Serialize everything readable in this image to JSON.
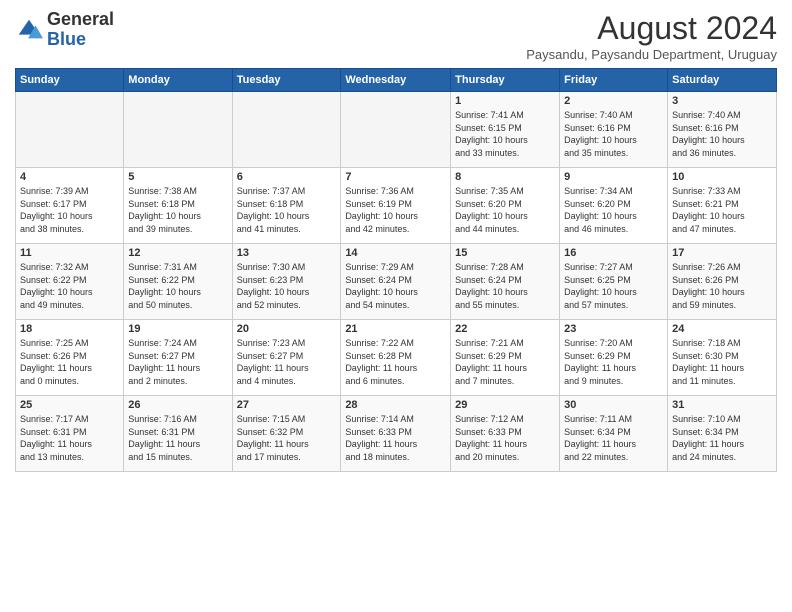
{
  "header": {
    "logo_general": "General",
    "logo_blue": "Blue",
    "main_title": "August 2024",
    "subtitle": "Paysandu, Paysandu Department, Uruguay"
  },
  "calendar": {
    "days_of_week": [
      "Sunday",
      "Monday",
      "Tuesday",
      "Wednesday",
      "Thursday",
      "Friday",
      "Saturday"
    ],
    "weeks": [
      [
        {
          "day": "",
          "info": ""
        },
        {
          "day": "",
          "info": ""
        },
        {
          "day": "",
          "info": ""
        },
        {
          "day": "",
          "info": ""
        },
        {
          "day": "1",
          "info": "Sunrise: 7:41 AM\nSunset: 6:15 PM\nDaylight: 10 hours\nand 33 minutes."
        },
        {
          "day": "2",
          "info": "Sunrise: 7:40 AM\nSunset: 6:16 PM\nDaylight: 10 hours\nand 35 minutes."
        },
        {
          "day": "3",
          "info": "Sunrise: 7:40 AM\nSunset: 6:16 PM\nDaylight: 10 hours\nand 36 minutes."
        }
      ],
      [
        {
          "day": "4",
          "info": "Sunrise: 7:39 AM\nSunset: 6:17 PM\nDaylight: 10 hours\nand 38 minutes."
        },
        {
          "day": "5",
          "info": "Sunrise: 7:38 AM\nSunset: 6:18 PM\nDaylight: 10 hours\nand 39 minutes."
        },
        {
          "day": "6",
          "info": "Sunrise: 7:37 AM\nSunset: 6:18 PM\nDaylight: 10 hours\nand 41 minutes."
        },
        {
          "day": "7",
          "info": "Sunrise: 7:36 AM\nSunset: 6:19 PM\nDaylight: 10 hours\nand 42 minutes."
        },
        {
          "day": "8",
          "info": "Sunrise: 7:35 AM\nSunset: 6:20 PM\nDaylight: 10 hours\nand 44 minutes."
        },
        {
          "day": "9",
          "info": "Sunrise: 7:34 AM\nSunset: 6:20 PM\nDaylight: 10 hours\nand 46 minutes."
        },
        {
          "day": "10",
          "info": "Sunrise: 7:33 AM\nSunset: 6:21 PM\nDaylight: 10 hours\nand 47 minutes."
        }
      ],
      [
        {
          "day": "11",
          "info": "Sunrise: 7:32 AM\nSunset: 6:22 PM\nDaylight: 10 hours\nand 49 minutes."
        },
        {
          "day": "12",
          "info": "Sunrise: 7:31 AM\nSunset: 6:22 PM\nDaylight: 10 hours\nand 50 minutes."
        },
        {
          "day": "13",
          "info": "Sunrise: 7:30 AM\nSunset: 6:23 PM\nDaylight: 10 hours\nand 52 minutes."
        },
        {
          "day": "14",
          "info": "Sunrise: 7:29 AM\nSunset: 6:24 PM\nDaylight: 10 hours\nand 54 minutes."
        },
        {
          "day": "15",
          "info": "Sunrise: 7:28 AM\nSunset: 6:24 PM\nDaylight: 10 hours\nand 55 minutes."
        },
        {
          "day": "16",
          "info": "Sunrise: 7:27 AM\nSunset: 6:25 PM\nDaylight: 10 hours\nand 57 minutes."
        },
        {
          "day": "17",
          "info": "Sunrise: 7:26 AM\nSunset: 6:26 PM\nDaylight: 10 hours\nand 59 minutes."
        }
      ],
      [
        {
          "day": "18",
          "info": "Sunrise: 7:25 AM\nSunset: 6:26 PM\nDaylight: 11 hours\nand 0 minutes."
        },
        {
          "day": "19",
          "info": "Sunrise: 7:24 AM\nSunset: 6:27 PM\nDaylight: 11 hours\nand 2 minutes."
        },
        {
          "day": "20",
          "info": "Sunrise: 7:23 AM\nSunset: 6:27 PM\nDaylight: 11 hours\nand 4 minutes."
        },
        {
          "day": "21",
          "info": "Sunrise: 7:22 AM\nSunset: 6:28 PM\nDaylight: 11 hours\nand 6 minutes."
        },
        {
          "day": "22",
          "info": "Sunrise: 7:21 AM\nSunset: 6:29 PM\nDaylight: 11 hours\nand 7 minutes."
        },
        {
          "day": "23",
          "info": "Sunrise: 7:20 AM\nSunset: 6:29 PM\nDaylight: 11 hours\nand 9 minutes."
        },
        {
          "day": "24",
          "info": "Sunrise: 7:18 AM\nSunset: 6:30 PM\nDaylight: 11 hours\nand 11 minutes."
        }
      ],
      [
        {
          "day": "25",
          "info": "Sunrise: 7:17 AM\nSunset: 6:31 PM\nDaylight: 11 hours\nand 13 minutes."
        },
        {
          "day": "26",
          "info": "Sunrise: 7:16 AM\nSunset: 6:31 PM\nDaylight: 11 hours\nand 15 minutes."
        },
        {
          "day": "27",
          "info": "Sunrise: 7:15 AM\nSunset: 6:32 PM\nDaylight: 11 hours\nand 17 minutes."
        },
        {
          "day": "28",
          "info": "Sunrise: 7:14 AM\nSunset: 6:33 PM\nDaylight: 11 hours\nand 18 minutes."
        },
        {
          "day": "29",
          "info": "Sunrise: 7:12 AM\nSunset: 6:33 PM\nDaylight: 11 hours\nand 20 minutes."
        },
        {
          "day": "30",
          "info": "Sunrise: 7:11 AM\nSunset: 6:34 PM\nDaylight: 11 hours\nand 22 minutes."
        },
        {
          "day": "31",
          "info": "Sunrise: 7:10 AM\nSunset: 6:34 PM\nDaylight: 11 hours\nand 24 minutes."
        }
      ]
    ]
  }
}
